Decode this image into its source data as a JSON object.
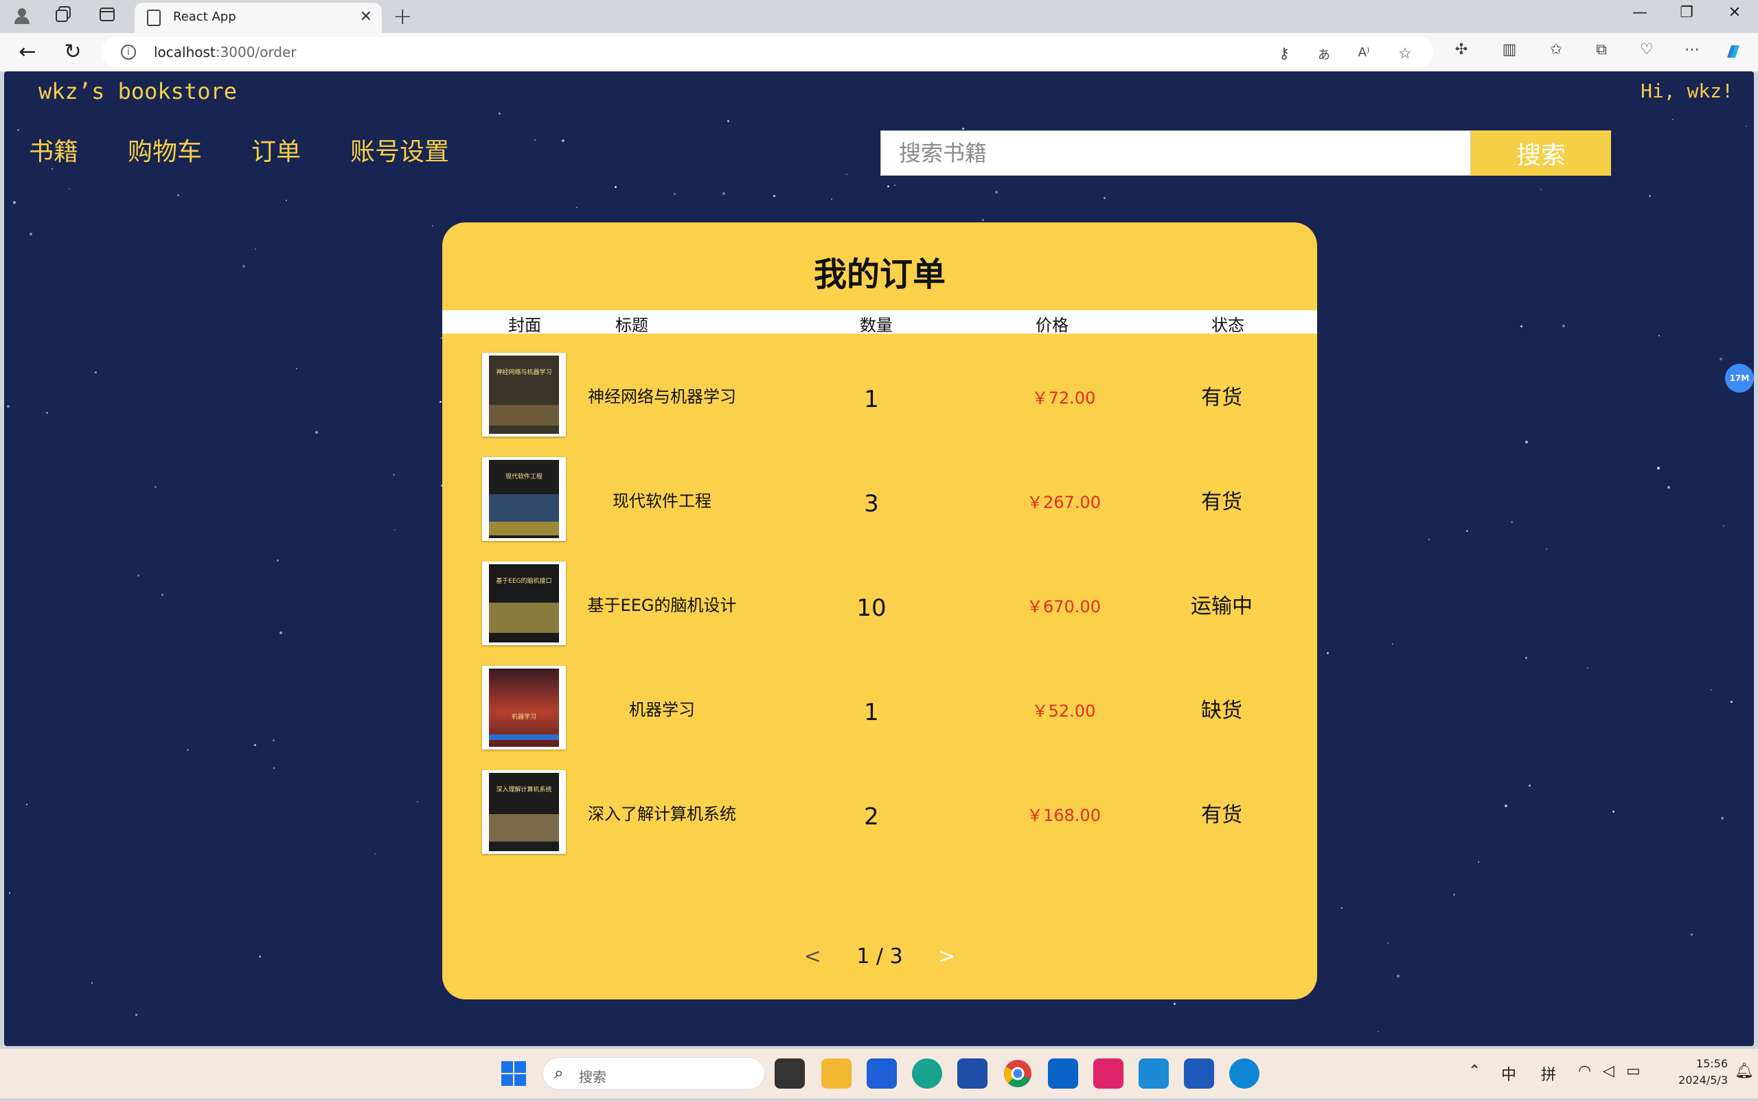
{
  "browser": {
    "tab_title": "React App",
    "url_host": "localhost",
    "url_rest": ":3000/order"
  },
  "header": {
    "brand": "wkz’s bookstore",
    "greeting": "Hi, wkz!",
    "nav": [
      "书籍",
      "购物车",
      "订单",
      "账号设置"
    ],
    "search_placeholder": "搜索书籍",
    "search_button": "搜索"
  },
  "orders": {
    "title": "我的订单",
    "columns": [
      "封面",
      "标题",
      "数量",
      "价格",
      "状态"
    ],
    "rows": [
      {
        "title": "神经网络与机器学习",
        "quantity": "1",
        "price": "￥72.00",
        "status": "有货",
        "cover_text": "神经网络与机器学习"
      },
      {
        "title": "现代软件工程",
        "quantity": "3",
        "price": "￥267.00",
        "status": "有货",
        "cover_text": "现代软件工程"
      },
      {
        "title": "基于EEG的脑机设计",
        "quantity": "10",
        "price": "￥670.00",
        "status": "运输中",
        "cover_text": "基于EEG的脑机接口"
      },
      {
        "title": "机器学习",
        "quantity": "1",
        "price": "￥52.00",
        "status": "缺货",
        "cover_text": "机器学习"
      },
      {
        "title": "深入了解计算机系统",
        "quantity": "2",
        "price": "￥168.00",
        "status": "有货",
        "cover_text": "深入理解计算机系统"
      }
    ],
    "pagination": {
      "prev": "<",
      "current": "1 / 3",
      "next": ">"
    }
  },
  "extension_badge": "17M",
  "taskbar": {
    "search_placeholder": "搜索",
    "ime_lang": "中",
    "ime_mode": "拼",
    "time": "15:56",
    "date": "2024/5/3"
  },
  "colors": {
    "page_bg": "#182452",
    "accent": "#f5cf46",
    "card_bg": "#fbd14c",
    "price": "#e22c1e"
  }
}
